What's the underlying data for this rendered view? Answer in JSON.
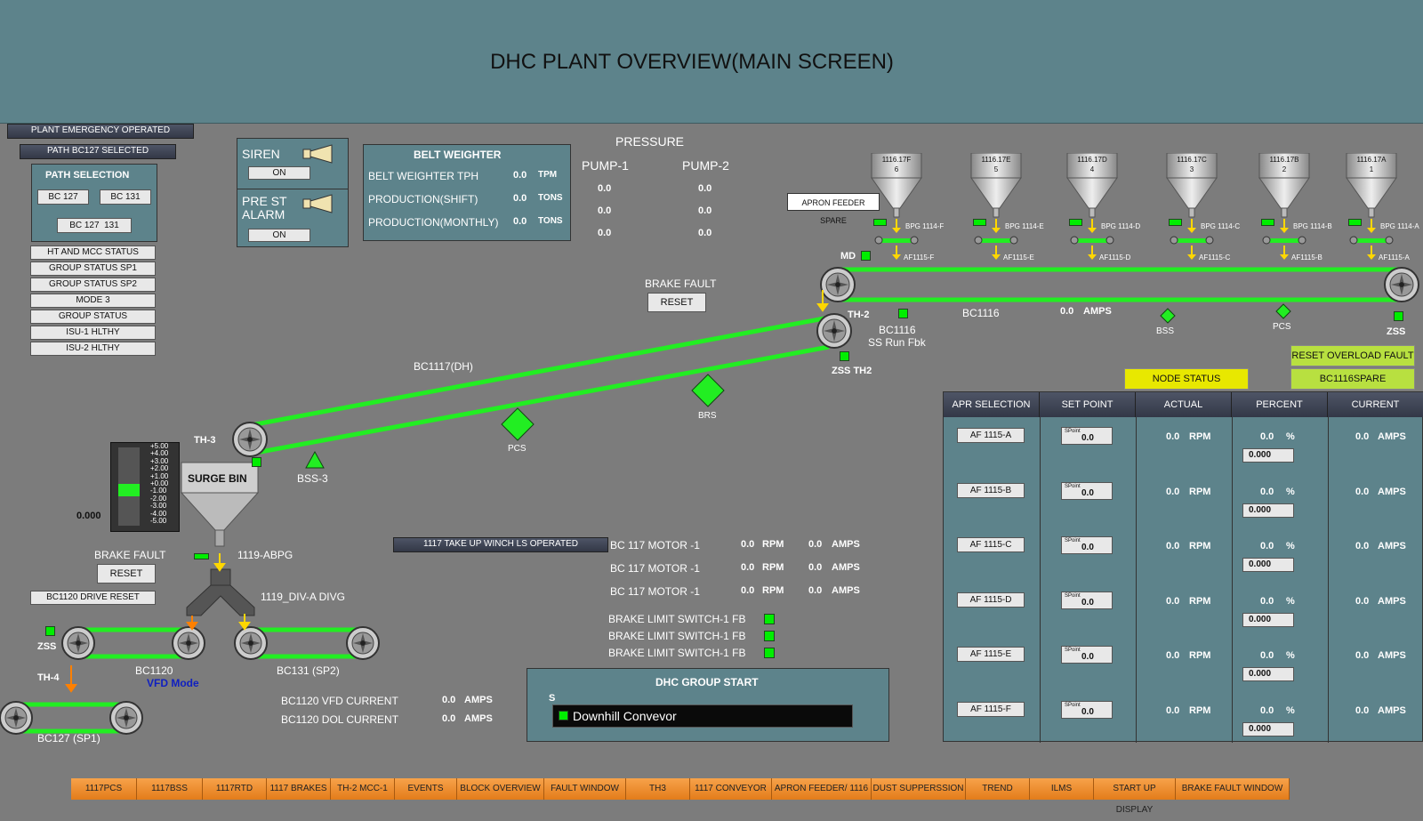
{
  "title": "DHC PLANT OVERVIEW(MAIN SCREEN)",
  "status_banners": {
    "emergency": "PLANT EMERGENCY OPERATED",
    "path_selected": "PATH BC127 SELECTED"
  },
  "path_selection": {
    "title": "PATH SELECTION",
    "buttons": [
      "BC 127",
      "BC 131",
      "BC 127  131"
    ]
  },
  "status_list": [
    "HT AND MCC STATUS",
    "GROUP STATUS SP1",
    "GROUP STATUS SP2",
    "MODE 3",
    "GROUP STATUS",
    "ISU-1 HLTHY",
    "ISU-2 HLTHY"
  ],
  "siren": {
    "label": "SIREN",
    "button": "ON"
  },
  "prestart": {
    "label": "PRE ST ALARM",
    "button": "ON"
  },
  "belt_weighter": {
    "title": "BELT WEIGHTER",
    "rows": [
      {
        "label": "BELT WEIGHTER TPH",
        "value": "0.0",
        "unit": "TPM"
      },
      {
        "label": "PRODUCTION(SHIFT)",
        "value": "0.0",
        "unit": "TONS"
      },
      {
        "label": "PRODUCTION(MONTHLY)",
        "value": "0.0",
        "unit": "TONS"
      }
    ]
  },
  "pressure": {
    "title": "PRESSURE",
    "pump1": {
      "label": "PUMP-1",
      "values": [
        "0.0",
        "0.0",
        "0.0"
      ]
    },
    "pump2": {
      "label": "PUMP-2",
      "values": [
        "0.0",
        "0.0",
        "0.0"
      ]
    }
  },
  "brake_fault_top": {
    "label": "BRAKE FAULT",
    "button": "RESET"
  },
  "apron_spare": "APRON FEEDER SPARE",
  "hoppers": [
    {
      "id": "1116.17F",
      "num": "6",
      "bpg": "BPG 1114-F",
      "af": "AF1115-F"
    },
    {
      "id": "1116.17E",
      "num": "5",
      "bpg": "BPG 1114-E",
      "af": "AF1115-E"
    },
    {
      "id": "1116.17D",
      "num": "4",
      "bpg": "BPG 1114-D",
      "af": "AF1115-D"
    },
    {
      "id": "1116.17C",
      "num": "3",
      "bpg": "BPG 1114-C",
      "af": "AF1115-C"
    },
    {
      "id": "1116.17B",
      "num": "2",
      "bpg": "BPG 1114-B",
      "af": "AF1115-B"
    },
    {
      "id": "1116.17A",
      "num": "1",
      "bpg": "BPG 1114-A",
      "af": "AF1115-A"
    }
  ],
  "bc1116": {
    "md": "MD",
    "th2": "TH-2",
    "name": "BC1116",
    "ss_label": "BC1116",
    "ss_sub": "SS Run Fbk",
    "amps_value": "0.0",
    "amps_unit": "AMPS",
    "bss": "BSS",
    "pcs": "PCS",
    "zss": "ZSS",
    "zss_th2": "ZSS TH2"
  },
  "bc1117": {
    "name": "BC1117(DH)",
    "pcs": "PCS",
    "brs": "BRS",
    "bss3": "BSS-3",
    "th3": "TH-3"
  },
  "surge_bin": {
    "label": "SURGE BIN",
    "level": "0.000",
    "scale": [
      "+5.00",
      "+4.00",
      "+3.00",
      "+2.00",
      "+1.00",
      "+0.00",
      "-1.00",
      "-2.00",
      "-3.00",
      "-4.00",
      "-5.00"
    ],
    "level_fraction": 0.45
  },
  "brake_fault_left": {
    "label": "BRAKE FAULT",
    "button": "RESET",
    "drive_reset": "BC1120 DRIVE RESET"
  },
  "abpg": "1119-ABPG",
  "div": "1119_DIV-A DIVG",
  "bc1120": {
    "name": "BC1120",
    "mode": "VFD Mode",
    "zss": "ZSS",
    "th4": "TH-4"
  },
  "bc131": "BC131 (SP2)",
  "bc127": "BC127 (SP1)",
  "currents": [
    {
      "label": "BC1120 VFD CURRENT",
      "value": "0.0",
      "unit": "AMPS"
    },
    {
      "label": "BC1120 DOL CURRENT",
      "value": "0.0",
      "unit": "AMPS"
    }
  ],
  "winch_banner": "1117 TAKE UP WINCH LS OPERATED",
  "motors": [
    {
      "label": "BC 117 MOTOR -1",
      "rpm": "0.0",
      "rpm_unit": "RPM",
      "amps": "0.0",
      "amps_unit": "AMPS"
    },
    {
      "label": "BC 117 MOTOR -1",
      "rpm": "0.0",
      "rpm_unit": "RPM",
      "amps": "0.0",
      "amps_unit": "AMPS"
    },
    {
      "label": "BC 117 MOTOR -1",
      "rpm": "0.0",
      "rpm_unit": "RPM",
      "amps": "0.0",
      "amps_unit": "AMPS"
    }
  ],
  "brake_limits": [
    "BRAKE LIMIT SWITCH-1 FB",
    "BRAKE LIMIT SWITCH-1 FB",
    "BRAKE LIMIT SWITCH-1 FB"
  ],
  "group_start": {
    "title": "DHC GROUP START",
    "s": "S",
    "item": "Downhill Convevor"
  },
  "reset_overload": "RESET OVERLOAD FAULT",
  "node_status": "NODE STATUS",
  "spare_button": "BC1116SPARE",
  "apron_table": {
    "headers": [
      "APR SELECTION",
      "SET POINT",
      "ACTUAL",
      "PERCENT",
      "CURRENT"
    ],
    "sp_tag": "SPoint",
    "rows": [
      {
        "sel": "AF 1115-A",
        "sp": "0.0",
        "actual": "0.0",
        "rpm": "RPM",
        "pct": "0.0",
        "pct_unit": "%",
        "pct_box": "0.000",
        "cur": "0.0",
        "amps": "AMPS"
      },
      {
        "sel": "AF 1115-B",
        "sp": "0.0",
        "actual": "0.0",
        "rpm": "RPM",
        "pct": "0.0",
        "pct_unit": "%",
        "pct_box": "0.000",
        "cur": "0.0",
        "amps": "AMPS"
      },
      {
        "sel": "AF 1115-C",
        "sp": "0.0",
        "actual": "0.0",
        "rpm": "RPM",
        "pct": "0.0",
        "pct_unit": "%",
        "pct_box": "0.000",
        "cur": "0.0",
        "amps": "AMPS"
      },
      {
        "sel": "AF 1115-D",
        "sp": "0.0",
        "actual": "0.0",
        "rpm": "RPM",
        "pct": "0.0",
        "pct_unit": "%",
        "pct_box": "0.000",
        "cur": "0.0",
        "amps": "AMPS"
      },
      {
        "sel": "AF 1115-E",
        "sp": "0.0",
        "actual": "0.0",
        "rpm": "RPM",
        "pct": "0.0",
        "pct_unit": "%",
        "pct_box": "0.000",
        "cur": "0.0",
        "amps": "AMPS"
      },
      {
        "sel": "AF 1115-F",
        "sp": "0.0",
        "actual": "0.0",
        "rpm": "RPM",
        "pct": "0.0",
        "pct_unit": "%",
        "pct_box": "0.000",
        "cur": "0.0",
        "amps": "AMPS"
      }
    ]
  },
  "nav": [
    "1117PCS",
    "1117BSS",
    "1117RTD",
    "1117 BRAKES",
    "TH-2 MCC-1",
    "EVENTS",
    "BLOCK OVERVIEW",
    "FAULT WINDOW",
    "TH3",
    "1117 CONVEYOR",
    "APRON FEEDER/ 1116",
    "DUST SUPPERSSION",
    "TREND",
    "ILMS",
    "START UP DISPLAY",
    "BRAKE FAULT WINDOW"
  ],
  "colors": {
    "belt": "#22ee22",
    "panel": "#5d838b",
    "background": "#7c7c7c",
    "nav": "#f08c2a",
    "arrow": "#ffd700"
  },
  "icons": {
    "siren": "horn-icon",
    "pulley": "pulley-icon",
    "hopper": "hopper-icon",
    "sensor": "diamond-sensor-icon"
  }
}
